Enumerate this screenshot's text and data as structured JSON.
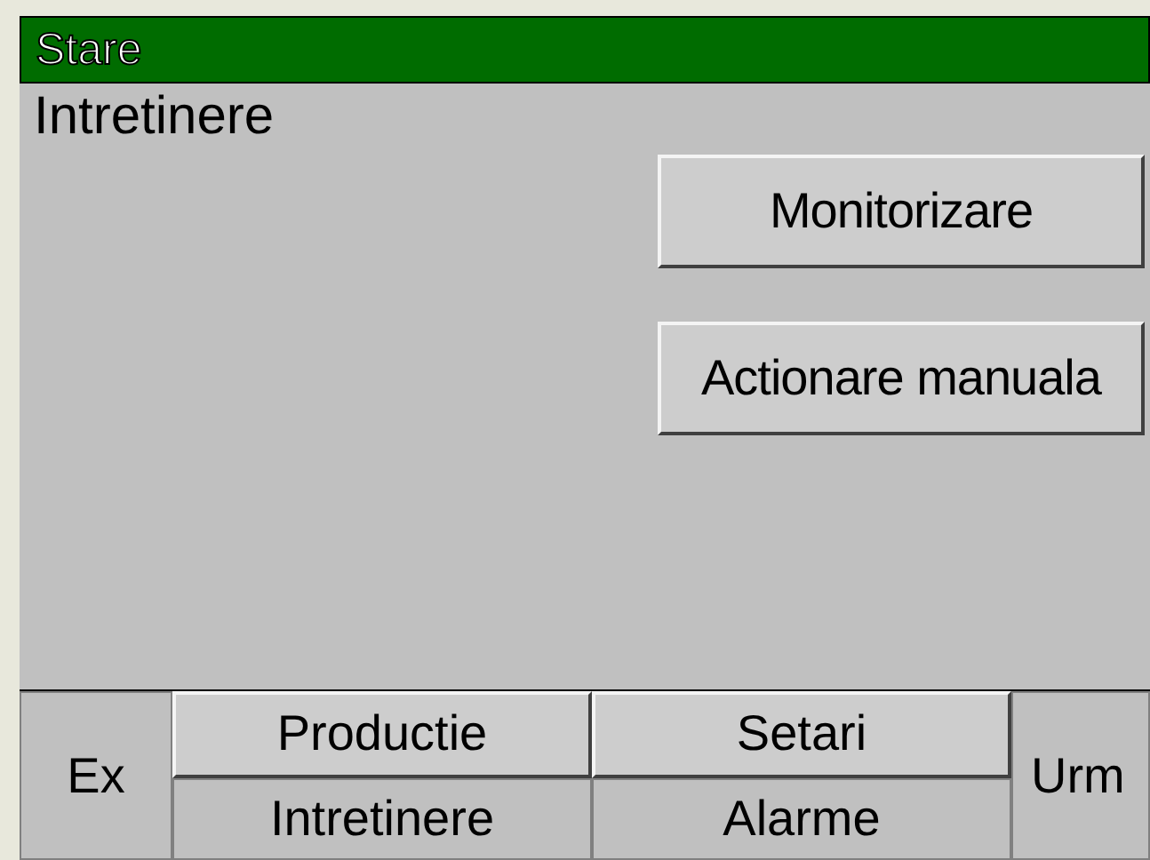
{
  "header": {
    "title": "Stare"
  },
  "status": "Intretinere",
  "actions": [
    "Monitorizare",
    "Actionare manuala"
  ],
  "nav": {
    "left": "Ex",
    "right": "Urm",
    "columns": [
      {
        "top": {
          "label": "Productie",
          "selected": false
        },
        "bottom": {
          "label": "Intretinere",
          "selected": true
        }
      },
      {
        "top": {
          "label": "Setari",
          "selected": false
        },
        "bottom": {
          "label": "Alarme",
          "selected": true
        }
      }
    ]
  }
}
